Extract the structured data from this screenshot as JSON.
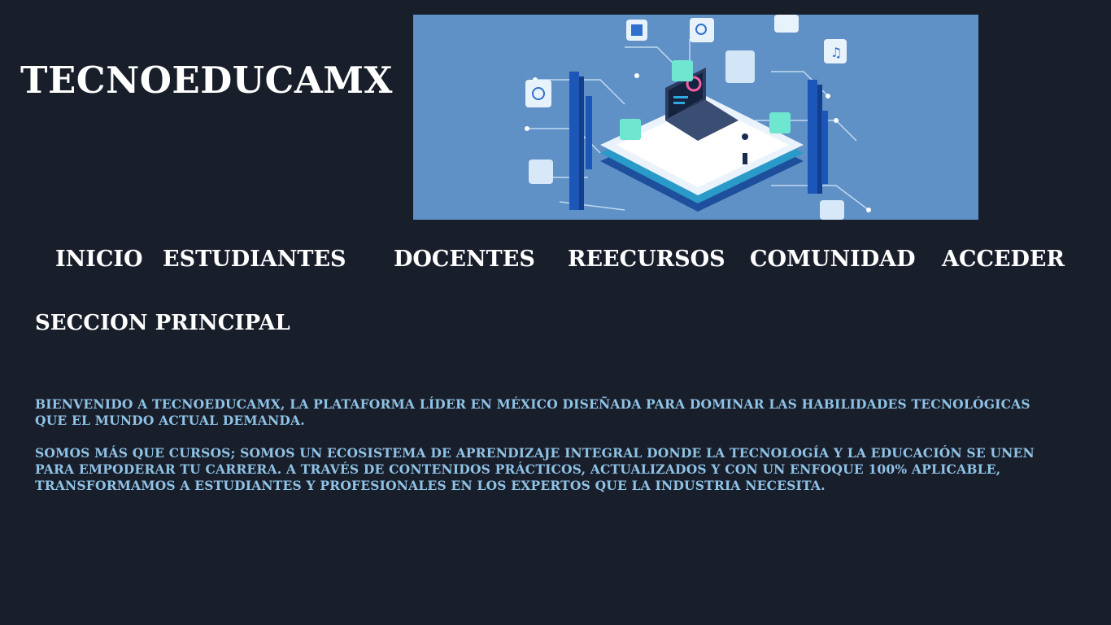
{
  "site": {
    "title": "TECNOEDUCAMX"
  },
  "nav": {
    "items": [
      {
        "label": "INICIO"
      },
      {
        "label": "ESTUDIANTES"
      },
      {
        "label": "DOCENTES"
      },
      {
        "label": "REECURSOS"
      },
      {
        "label": "COMUNIDAD"
      },
      {
        "label": "ACCEDER"
      }
    ]
  },
  "main": {
    "section_title": "SECCION PRINCIPAL",
    "paragraphs": [
      "BIENVENIDO A TECNOEDUCAMX, LA PLATAFORMA LÍDER EN MÉXICO DISEÑADA PARA DOMINAR LAS HABILIDADES TECNOLÓGICAS QUE EL MUNDO ACTUAL DEMANDA.",
      "SOMOS MÁS QUE CURSOS; SOMOS UN ECOSISTEMA DE APRENDIZAJE INTEGRAL DONDE LA TECNOLOGÍA Y LA EDUCACIÓN SE UNEN PARA EMPODERAR TU CARRERA. A TRAVÉS DE CONTENIDOS PRÁCTICOS, ACTUALIZADOS Y CON UN ENFOQUE 100% APLICABLE, TRANSFORMAMOS A ESTUDIANTES Y PROFESIONALES EN LOS EXPERTOS QUE LA INDUSTRIA NECESITA."
    ]
  },
  "colors": {
    "background": "#191e2b",
    "text": "#ffffff",
    "paragraph": "#8fc3e6",
    "hero_bg": "#5f90c6"
  }
}
